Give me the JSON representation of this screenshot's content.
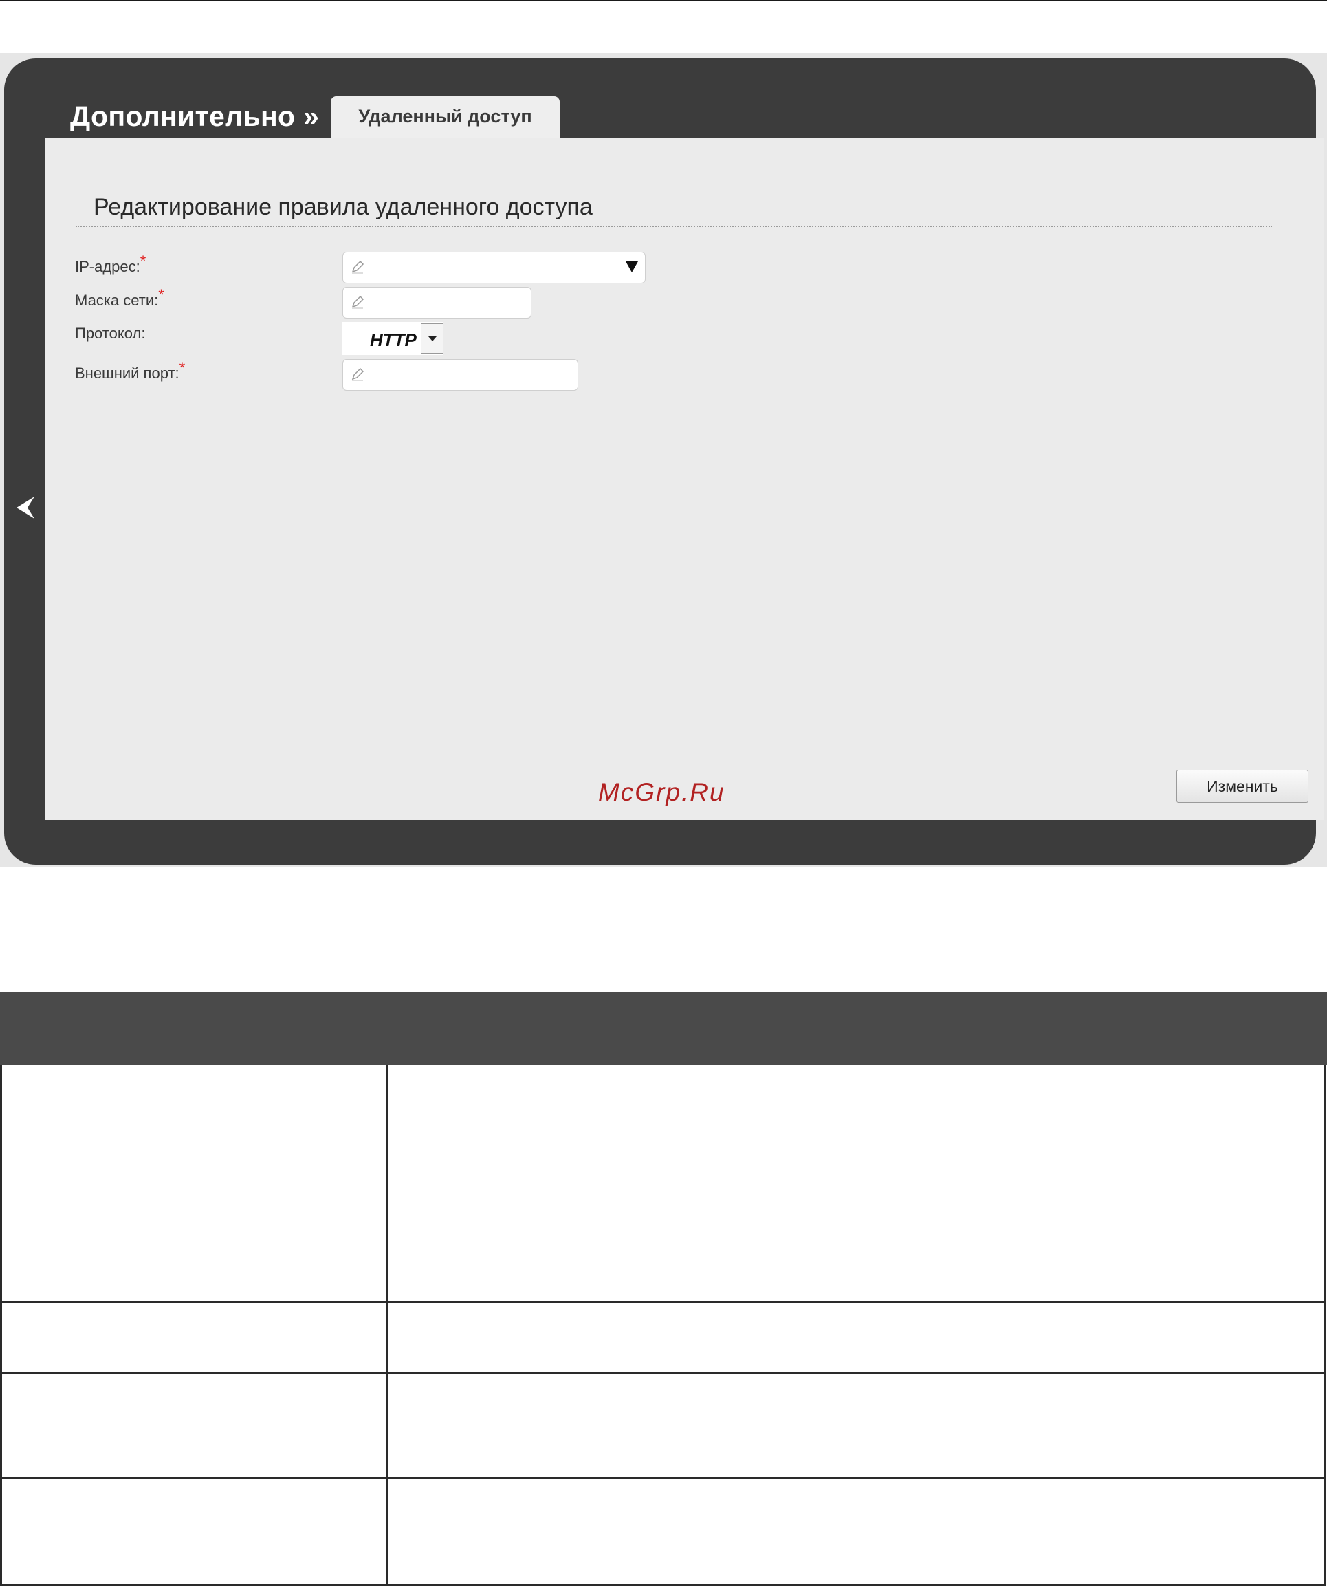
{
  "header": {
    "breadcrumb": "Дополнительно »",
    "active_tab": "Удаленный доступ"
  },
  "form": {
    "section_title": "Редактирование правила удаленного доступа",
    "required_marker": "*",
    "fields": {
      "ip_address": {
        "label": "IP-адрес:",
        "value": ""
      },
      "netmask": {
        "label": "Маска сети:",
        "value": ""
      },
      "protocol": {
        "label": "Протокол:",
        "value": "HTTP"
      },
      "external_port": {
        "label": "Внешний порт:",
        "value": ""
      }
    },
    "submit_label": "Изменить"
  },
  "watermark": "McGrp.Ru",
  "icons": {
    "back": "chevron-left-icon",
    "edit": "pencil-icon",
    "dropdown": "triangle-down-icon"
  },
  "colors": {
    "frame": "#3c3c3c",
    "panel": "#ebebeb",
    "required": "#e02020",
    "watermark": "#b22222",
    "table_header": "#4a4a4a"
  }
}
